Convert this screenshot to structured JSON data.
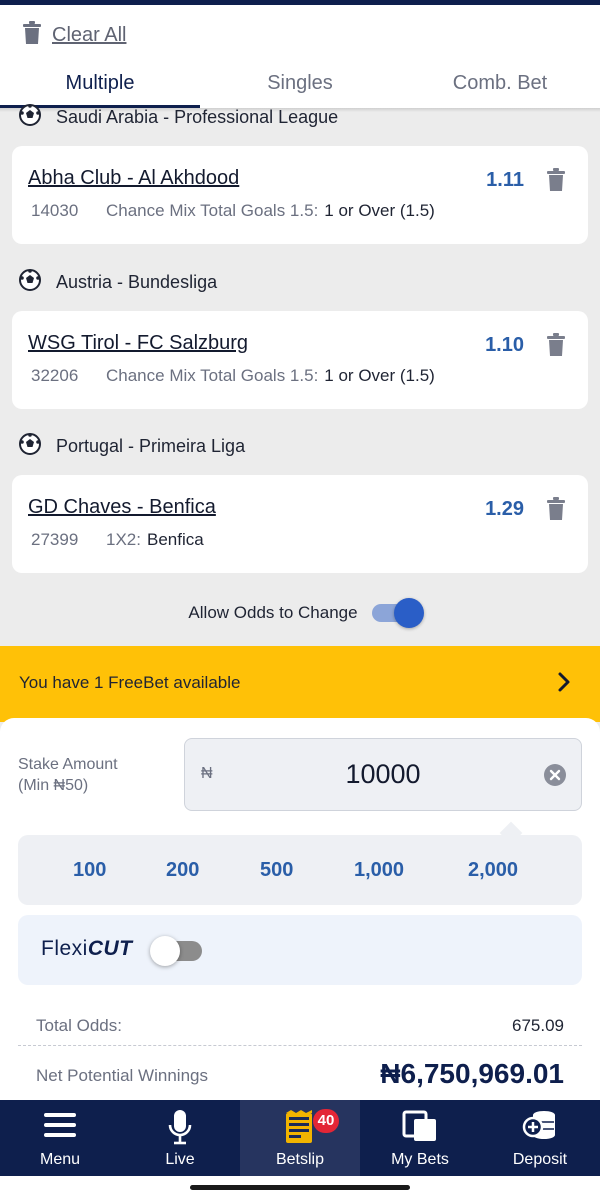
{
  "header": {
    "clear_all": "Clear All",
    "tabs": [
      {
        "label": "Multiple",
        "active": true
      },
      {
        "label": "Singles",
        "active": false
      },
      {
        "label": "Comb. Bet",
        "active": false
      }
    ]
  },
  "bets": [
    {
      "league": "Saudi Arabia - Professional League",
      "match": "Abha Club - Al Akhdood",
      "code": "14030",
      "market": "Chance Mix Total Goals 1.5:",
      "selection": "1 or Over (1.5)",
      "odds": "1.11"
    },
    {
      "league": "Austria - Bundesliga",
      "match": "WSG Tirol - FC Salzburg",
      "code": "32206",
      "market": "Chance Mix Total Goals 1.5:",
      "selection": "1 or Over (1.5)",
      "odds": "1.10"
    },
    {
      "league": "Portugal - Primeira Liga",
      "match": "GD Chaves - Benfica",
      "code": "27399",
      "market": "1X2:",
      "selection": "Benfica",
      "odds": "1.29"
    }
  ],
  "odds_change": {
    "label": "Allow Odds to Change",
    "enabled": true
  },
  "freebet": {
    "text": "You have 1 FreeBet available"
  },
  "stake": {
    "label_line1": "Stake Amount",
    "label_line2": "(Min ₦50)",
    "currency": "₦",
    "value": "10000",
    "quick_amounts": [
      "100",
      "200",
      "500",
      "1,000",
      "2,000"
    ]
  },
  "flexicut": {
    "logo_part1": "Flexi",
    "logo_part2": "CUT",
    "enabled": false
  },
  "totals": {
    "total_odds_label": "Total Odds:",
    "total_odds_value": "675.09",
    "winnings_label": "Net Potential Winnings",
    "winnings_value": "₦6,750,969.01"
  },
  "nav": {
    "items": [
      {
        "label": "Menu",
        "icon": "hamburger-icon"
      },
      {
        "label": "Live",
        "icon": "microphone-icon"
      },
      {
        "label": "Betslip",
        "icon": "betslip-icon",
        "badge": "40",
        "active": true
      },
      {
        "label": "My Bets",
        "icon": "my-bets-icon"
      },
      {
        "label": "Deposit",
        "icon": "deposit-coins-icon"
      }
    ]
  },
  "colors": {
    "navy": "#0e1f4d",
    "accent_blue": "#2a5ea8",
    "freebet_yellow": "#ffc107",
    "badge_red": "#e32636"
  }
}
